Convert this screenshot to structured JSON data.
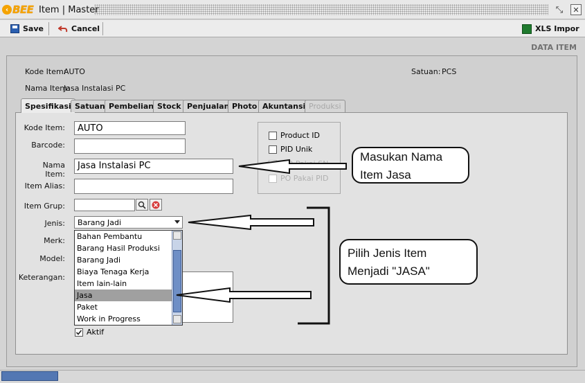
{
  "window": {
    "logo_text": "BEE",
    "title": "Item | Master",
    "restore_glyph": "⤡",
    "close_glyph": "✕"
  },
  "toolbar": {
    "save_label": "Save",
    "cancel_label": "Cancel",
    "xls_label": "XLS Impor",
    "xls_icon_text": "X"
  },
  "header": {
    "section_title": "DATA ITEM",
    "kode_item_label": "Kode Item:",
    "kode_item_value": "AUTO",
    "nama_item_label": "Nama Item:",
    "nama_item_value": "Jasa Instalasi PC",
    "satuan_label": "Satuan:",
    "satuan_value": "PCS"
  },
  "tabs": [
    {
      "label": "Spesifikasi",
      "state": "active"
    },
    {
      "label": "Satuan",
      "state": "normal"
    },
    {
      "label": "Pembelian",
      "state": "normal"
    },
    {
      "label": "Stock",
      "state": "normal"
    },
    {
      "label": "Penjualan",
      "state": "normal"
    },
    {
      "label": "Photo",
      "state": "normal"
    },
    {
      "label": "Akuntansi",
      "state": "normal"
    },
    {
      "label": "Produksi",
      "state": "disabled"
    }
  ],
  "form": {
    "kode_item_label": "Kode Item:",
    "kode_item_value": "AUTO",
    "barcode_label": "Barcode:",
    "barcode_value": "",
    "nama_item_label": "Nama Item:",
    "nama_item_value": "Jasa Instalasi PC",
    "item_alias_label": "Item Alias:",
    "item_alias_value": "",
    "item_grup_label": "Item Grup:",
    "item_grup_value": "",
    "jenis_label": "Jenis:",
    "jenis_value": "Barang Jadi",
    "merk_label": "Merk:",
    "model_label": "Model:",
    "keterangan_label": "Keterangan:",
    "aktif_label": "Aktif",
    "aktif_checked": true
  },
  "checkboxes": [
    {
      "label": "Product ID",
      "enabled": true,
      "checked": false
    },
    {
      "label": "PID Unik",
      "enabled": true,
      "checked": false
    },
    {
      "label": "PID Pakai SN",
      "enabled": false,
      "checked": false
    },
    {
      "label": "PO Pakai PID",
      "enabled": false,
      "checked": false
    }
  ],
  "jenis_options": [
    {
      "label": "Bahan Pembantu",
      "selected": false
    },
    {
      "label": "Barang Hasil Produksi",
      "selected": false
    },
    {
      "label": "Barang Jadi",
      "selected": false
    },
    {
      "label": "Biaya Tenaga Kerja",
      "selected": false
    },
    {
      "label": "Item lain-lain",
      "selected": false
    },
    {
      "label": "Jasa",
      "selected": true
    },
    {
      "label": "Paket",
      "selected": false
    },
    {
      "label": "Work in Progress",
      "selected": false
    }
  ],
  "annotations": {
    "callout1_line1": "Masukan Nama",
    "callout1_line2": "Item Jasa",
    "callout2_line1": "Pilih Jenis Item",
    "callout2_line2": "Menjadi \"JASA\""
  },
  "colors": {
    "accent": "#f5a300",
    "selection": "#a0a0a0",
    "scroll_thumb": "#6f8fc6"
  }
}
